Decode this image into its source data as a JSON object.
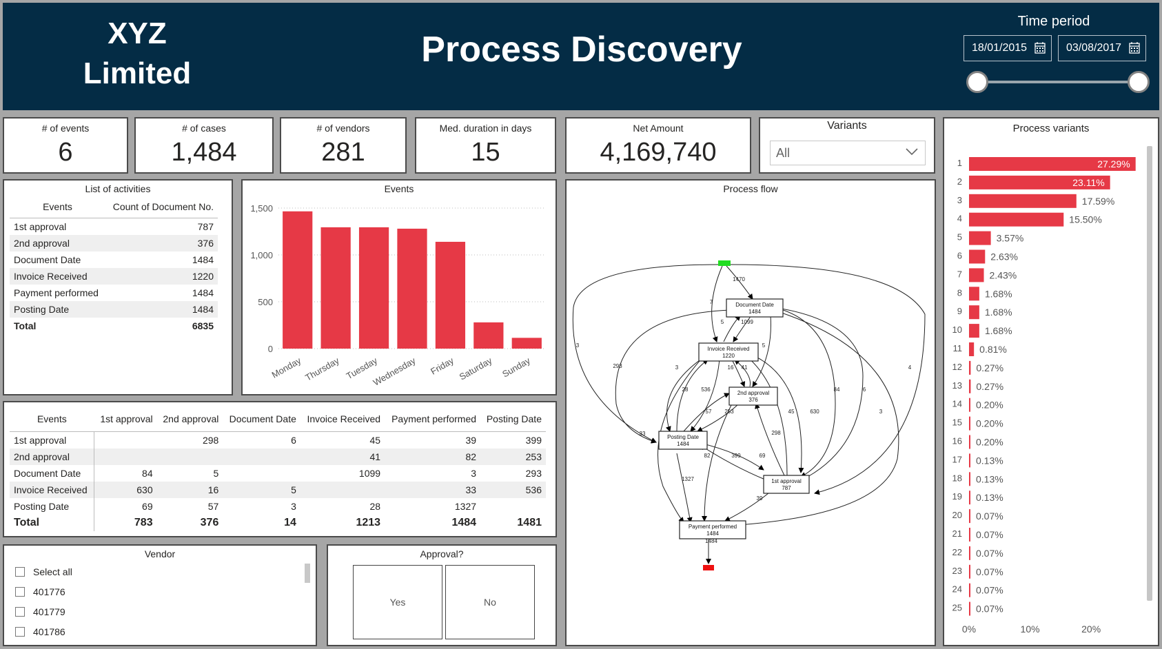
{
  "header": {
    "company_line1": "XYZ",
    "company_line2": "Limited",
    "title": "Process Discovery",
    "time_period_label": "Time period",
    "start_date": "18/01/2015",
    "end_date": "03/08/2017"
  },
  "kpis": {
    "events": {
      "label": "# of events",
      "value": "6"
    },
    "cases": {
      "label": "# of cases",
      "value": "1,484"
    },
    "vendors": {
      "label": "# of vendors",
      "value": "281"
    },
    "duration": {
      "label": "Med. duration in days",
      "value": "15"
    },
    "net_amount": {
      "label": "Net Amount",
      "value": "4,169,740"
    }
  },
  "variants_filter": {
    "label": "Variants",
    "selected": "All"
  },
  "activities": {
    "title": "List of activities",
    "col_events": "Events",
    "col_count": "Count of Document No.",
    "rows": [
      {
        "name": "1st approval",
        "count": "787"
      },
      {
        "name": "2nd approval",
        "count": "376"
      },
      {
        "name": "Document Date",
        "count": "1484"
      },
      {
        "name": "Invoice Received",
        "count": "1220"
      },
      {
        "name": "Payment performed",
        "count": "1484"
      },
      {
        "name": "Posting Date",
        "count": "1484"
      }
    ],
    "total_label": "Total",
    "total_value": "6835"
  },
  "matrix": {
    "headers": [
      "Events",
      "1st approval",
      "2nd approval",
      "Document Date",
      "Invoice Received",
      "Payment performed",
      "Posting Date"
    ],
    "rows": [
      [
        "1st approval",
        "",
        "298",
        "6",
        "45",
        "39",
        "399"
      ],
      [
        "2nd approval",
        "",
        "",
        "",
        "41",
        "82",
        "253"
      ],
      [
        "Document Date",
        "84",
        "5",
        "",
        "1099",
        "3",
        "293"
      ],
      [
        "Invoice Received",
        "630",
        "16",
        "5",
        "",
        "33",
        "536"
      ],
      [
        "Posting Date",
        "69",
        "57",
        "3",
        "28",
        "1327",
        ""
      ]
    ],
    "total": [
      "Total",
      "783",
      "376",
      "14",
      "1213",
      "1484",
      "1481"
    ]
  },
  "vendor": {
    "title": "Vendor",
    "items": [
      "Select all",
      "401776",
      "401779",
      "401786"
    ]
  },
  "approval": {
    "title": "Approval?",
    "yes": "Yes",
    "no": "No"
  },
  "process_flow": {
    "title": "Process flow",
    "nodes": [
      {
        "id": "doc",
        "label": "Document Date",
        "count": "1484"
      },
      {
        "id": "inv",
        "label": "Invoice Received",
        "count": "1220"
      },
      {
        "id": "app2",
        "label": "2nd approval",
        "count": "376"
      },
      {
        "id": "post",
        "label": "Posting Date",
        "count": "1484"
      },
      {
        "id": "app1",
        "label": "1st approval",
        "count": "787"
      },
      {
        "id": "pay",
        "label": "Payment performed",
        "count": "1484"
      }
    ],
    "edge_labels": [
      "1470",
      "7",
      "5",
      "1099",
      "3",
      "293",
      "5",
      "3",
      "16",
      "41",
      "28",
      "536",
      "57",
      "253",
      "84",
      "6",
      "4",
      "33",
      "298",
      "45",
      "630",
      "3",
      "82",
      "399",
      "69",
      "1327",
      "39",
      "1484"
    ],
    "colors": {
      "start": "#22dd22",
      "end": "#ee1111"
    }
  },
  "chart_data": [
    {
      "type": "bar",
      "title": "Events",
      "categories": [
        "Monday",
        "Thursday",
        "Tuesday",
        "Wednesday",
        "Friday",
        "Saturday",
        "Sunday"
      ],
      "values": [
        1465,
        1295,
        1295,
        1280,
        1140,
        280,
        115
      ],
      "ylim": [
        0,
        1500
      ],
      "yticks": [
        "0",
        "500",
        "1,000",
        "1,500"
      ],
      "grid": true,
      "color": "#e63946"
    },
    {
      "type": "bar",
      "orientation": "horizontal",
      "title": "Process variants",
      "categories": [
        "1",
        "2",
        "3",
        "4",
        "5",
        "6",
        "7",
        "8",
        "9",
        "10",
        "11",
        "12",
        "13",
        "14",
        "15",
        "16",
        "17",
        "18",
        "19",
        "20",
        "21",
        "22",
        "23",
        "24",
        "25"
      ],
      "values": [
        27.29,
        23.11,
        17.59,
        15.5,
        3.57,
        2.63,
        2.43,
        1.68,
        1.68,
        1.68,
        0.81,
        0.27,
        0.27,
        0.2,
        0.2,
        0.2,
        0.13,
        0.13,
        0.13,
        0.07,
        0.07,
        0.07,
        0.07,
        0.07,
        0.07
      ],
      "labels": [
        "27.29%",
        "23.11%",
        "17.59%",
        "15.50%",
        "3.57%",
        "2.63%",
        "2.43%",
        "1.68%",
        "1.68%",
        "1.68%",
        "0.81%",
        "0.27%",
        "0.27%",
        "0.20%",
        "0.20%",
        "0.20%",
        "0.13%",
        "0.13%",
        "0.13%",
        "0.07%",
        "0.07%",
        "0.07%",
        "0.07%",
        "0.07%",
        "0.07%"
      ],
      "xticks": [
        "0%",
        "10%",
        "20%"
      ],
      "xlim": [
        0,
        28
      ],
      "color": "#e63946"
    }
  ]
}
